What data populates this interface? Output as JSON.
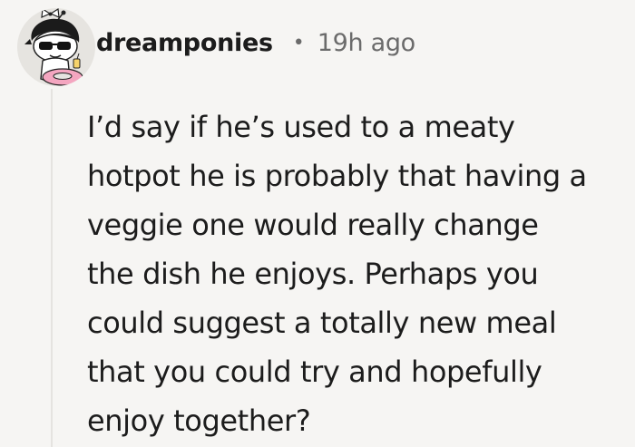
{
  "comment": {
    "author": "dreamponies",
    "separator": "•",
    "timestamp": "19h ago",
    "avatar_icon": "snoo-avatar-icon",
    "body_lines": [
      "I’d say if he’s used to a meaty",
      "hotpot he is probably that having a",
      "veggie one would really change",
      "the dish he enjoys. Perhaps you",
      "could suggest a totally new meal",
      "that you could try and hopefully",
      "enjoy together?"
    ]
  },
  "colors": {
    "background": "#f6f5f3",
    "text": "#1c1c1c",
    "meta": "#6b6b6b",
    "avatar_bg": "#e6e4e0",
    "accent_pink": "#f4a6c0"
  }
}
